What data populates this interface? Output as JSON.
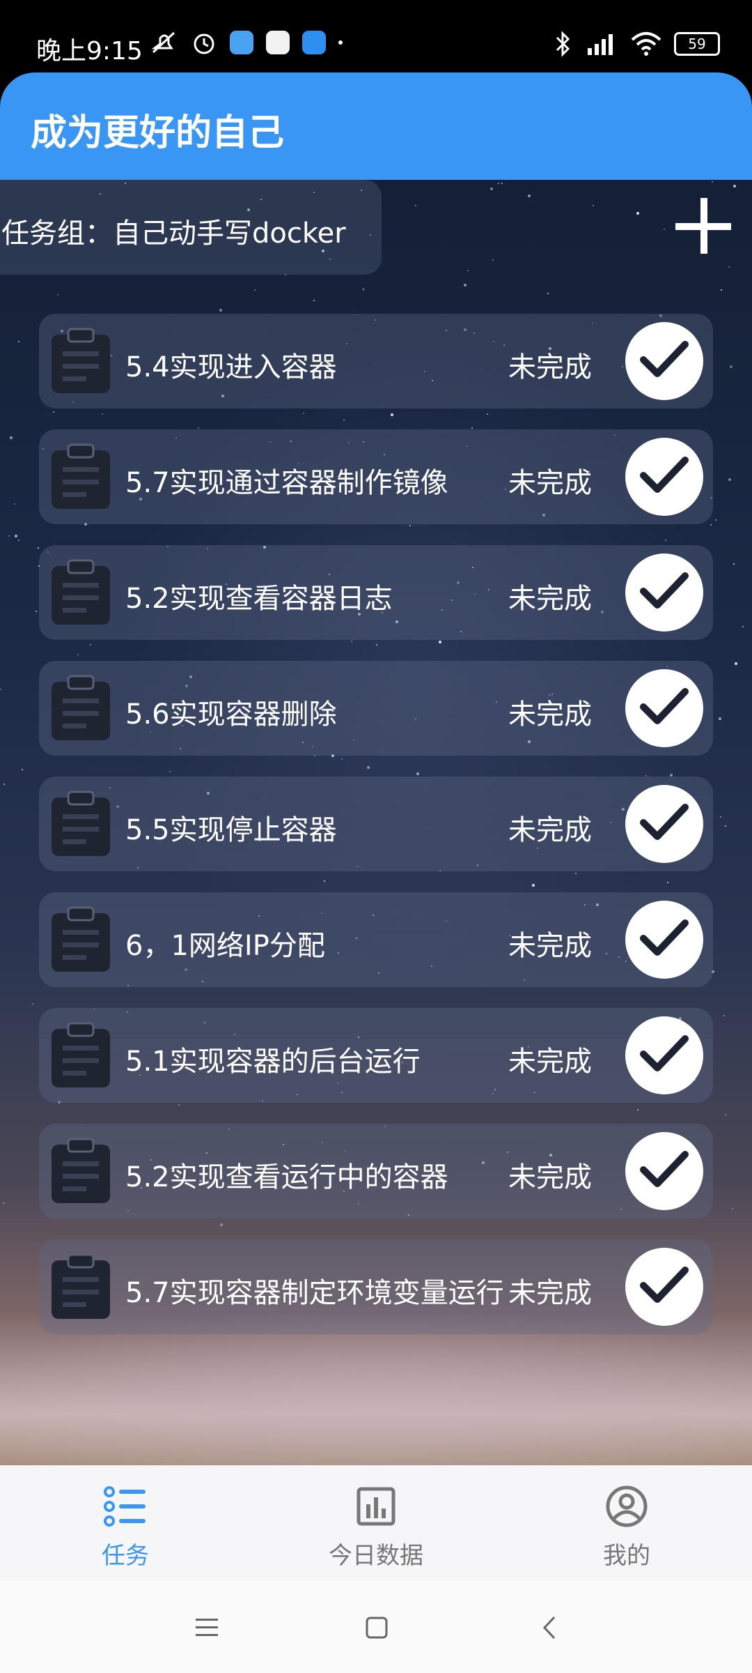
{
  "status_bar": {
    "time": "晚上9:15",
    "battery": "59"
  },
  "app": {
    "title": "成为更好的自己"
  },
  "task_group": {
    "label": "任务组：自己动手写docker"
  },
  "tasks": [
    {
      "name": "5.4实现进入容器",
      "status": "未完成"
    },
    {
      "name": "5.7实现通过容器制作镜像",
      "status": "未完成"
    },
    {
      "name": "5.2实现查看容器日志",
      "status": "未完成"
    },
    {
      "name": "5.6实现容器删除",
      "status": "未完成"
    },
    {
      "name": "5.5实现停止容器",
      "status": "未完成"
    },
    {
      "name": "6，1网络IP分配",
      "status": "未完成"
    },
    {
      "name": "5.1实现容器的后台运行",
      "status": "未完成"
    },
    {
      "name": "5.2实现查看运行中的容器",
      "status": "未完成"
    },
    {
      "name": "5.7实现容器制定环境变量运行",
      "status": "未完成"
    }
  ],
  "bottom_nav": {
    "tasks": "任务",
    "today_data": "今日数据",
    "mine": "我的",
    "active": "tasks",
    "active_color": "#3a96f5",
    "inactive_color": "#777777"
  },
  "colors": {
    "header": "#3a96f5"
  },
  "icons": {
    "task_item": "clipboard-icon",
    "complete": "check-icon",
    "add": "plus-icon"
  }
}
